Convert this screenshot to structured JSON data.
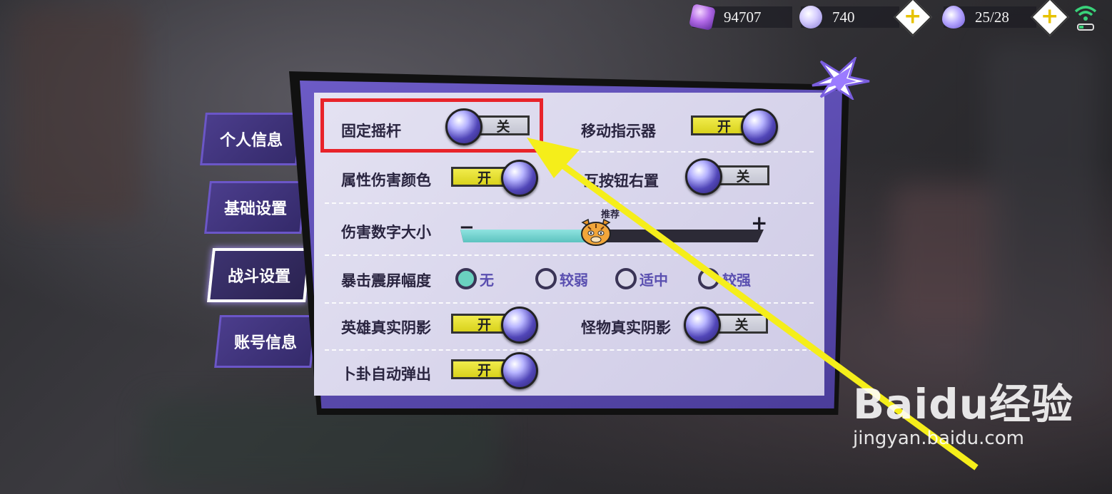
{
  "resources": [
    {
      "name": "gem",
      "value": "94707"
    },
    {
      "name": "orb",
      "value": "740"
    },
    {
      "name": "stamina",
      "value": "25/28"
    }
  ],
  "tabs": [
    "个人信息",
    "基础设置",
    "战斗设置",
    "账号信息"
  ],
  "active_tab": "战斗设置",
  "settings": {
    "fixed_joystick": {
      "label": "固定摇杆",
      "state": "关"
    },
    "move_indicator": {
      "label": "移动指示器",
      "state": "开"
    },
    "attr_damage_color": {
      "label": "属性伤害颜色",
      "state": "开"
    },
    "interact_button_right": {
      "label": "互按钮右置",
      "state": "关"
    },
    "damage_number_size": {
      "label": "伤害数字大小",
      "minus": "−",
      "plus": "+",
      "hint": "推荐",
      "level": 0.42
    },
    "crit_shake": {
      "label": "暴击震屏幅度",
      "options": [
        "无",
        "较弱",
        "适中",
        "较强"
      ],
      "selected": "无"
    },
    "hero_shadow": {
      "label": "英雄真实阴影",
      "state": "开"
    },
    "monster_shadow": {
      "label": "怪物真实阴影",
      "state": "关"
    },
    "divination_popup": {
      "label": "卜卦自动弹出",
      "state": "开"
    }
  },
  "watermark": {
    "brand": "Baidu经验",
    "url": "jingyan.baidu.com"
  }
}
